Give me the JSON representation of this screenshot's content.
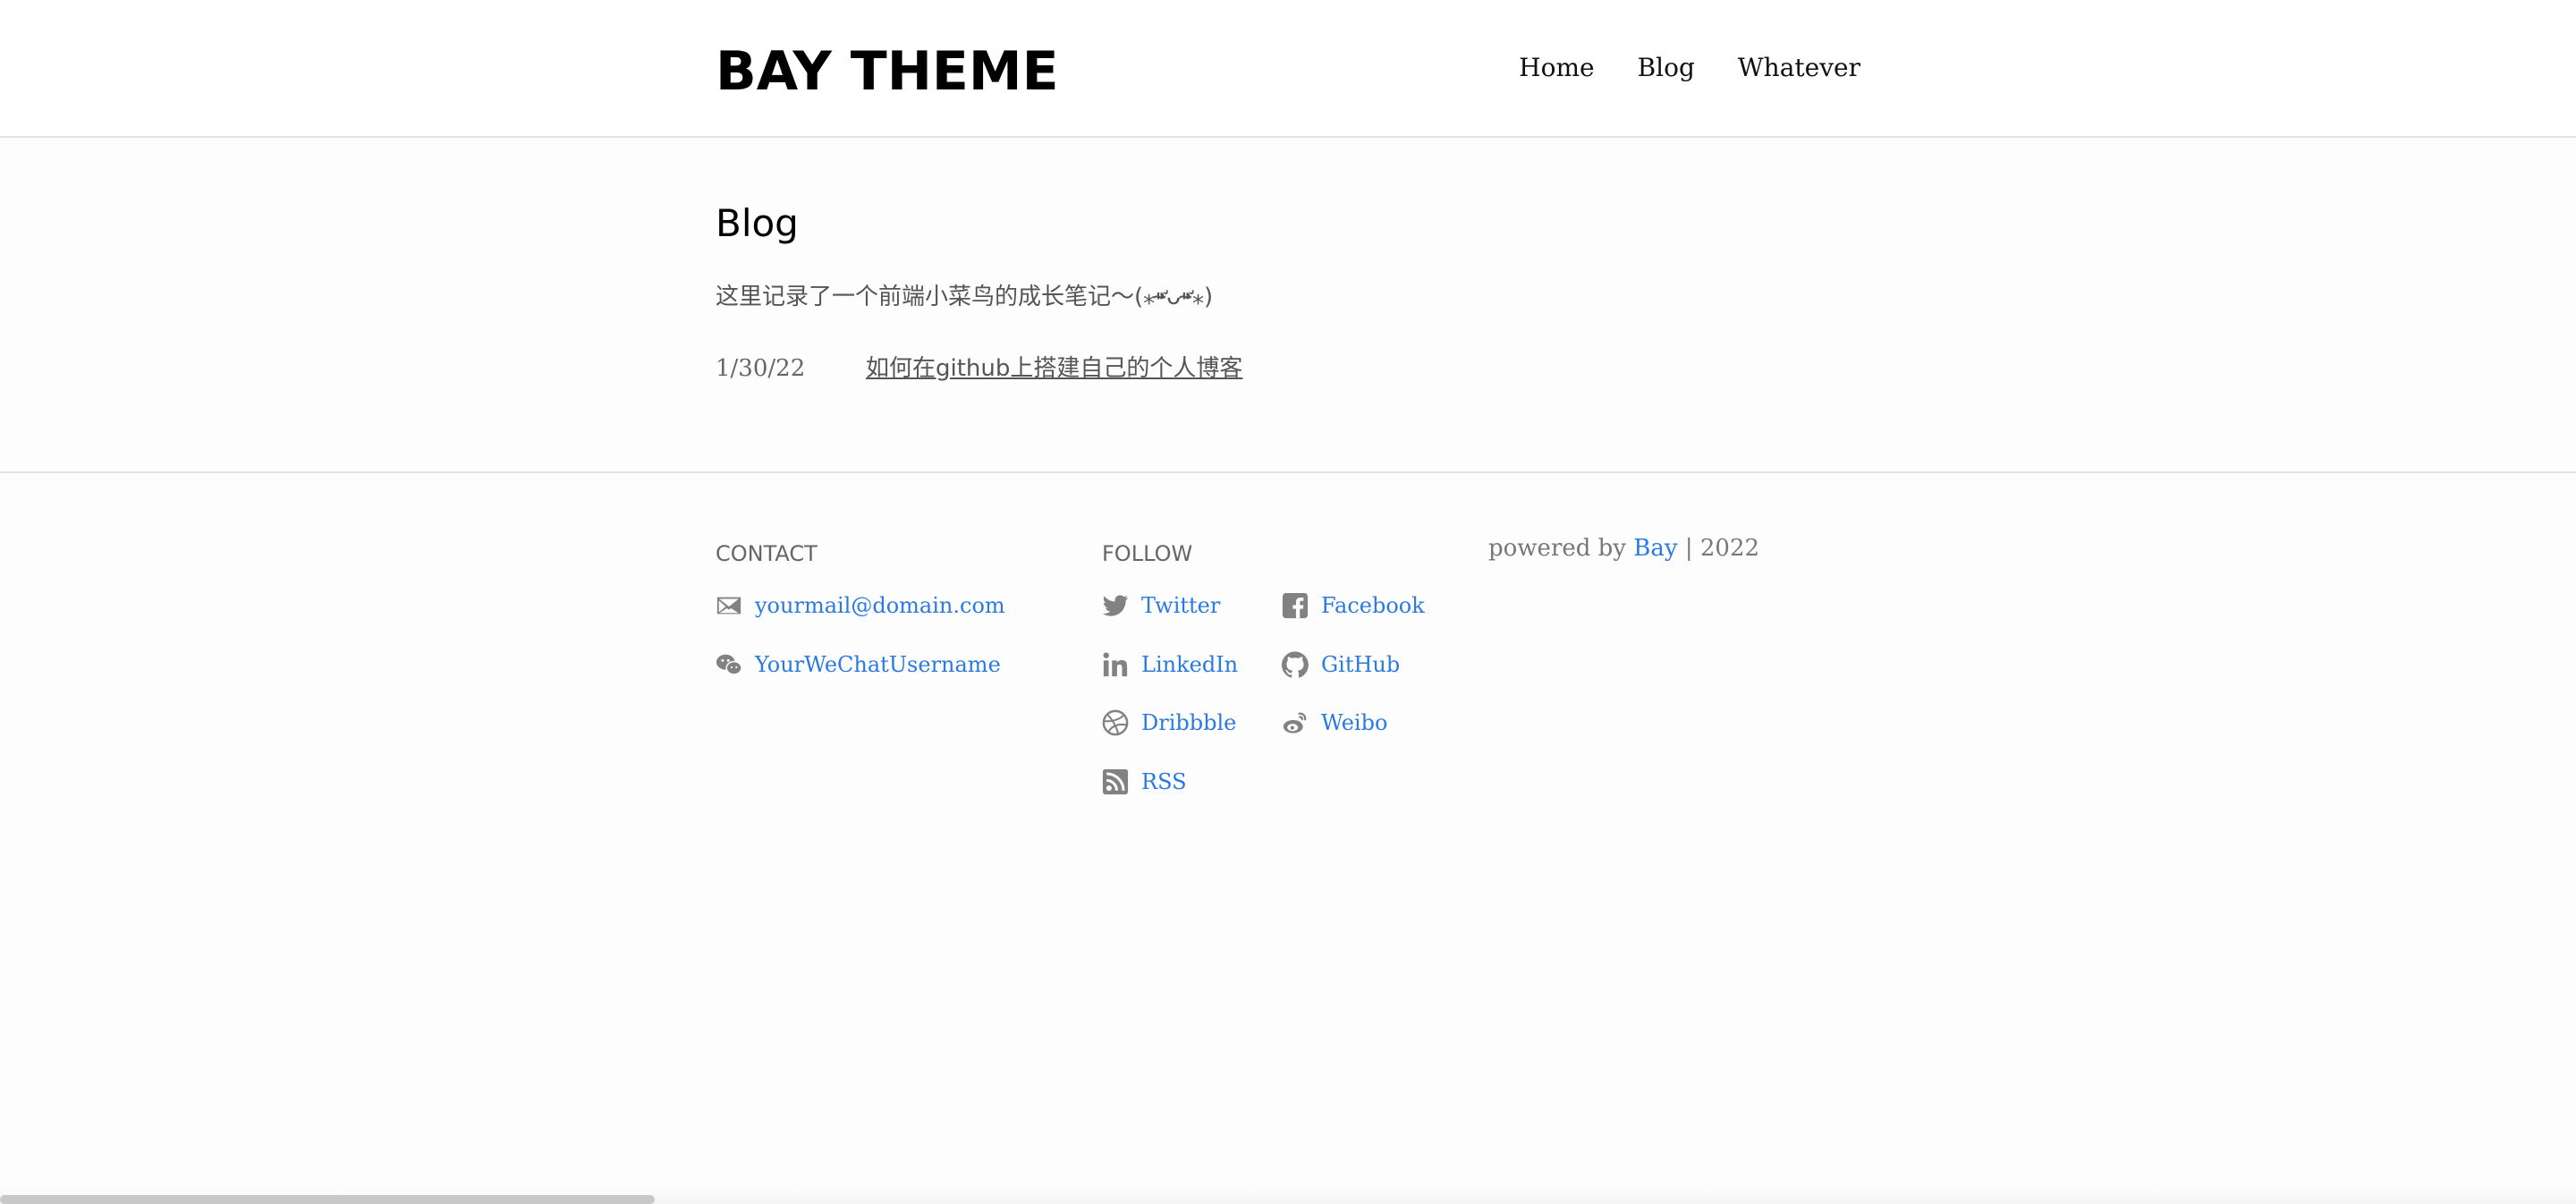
{
  "header": {
    "logo": "BAY THEME",
    "nav": [
      "Home",
      "Blog",
      "Whatever"
    ]
  },
  "main": {
    "title": "Blog",
    "intro": "这里记录了一个前端小菜鸟的成长笔记～(⁎⁍̴̛ᴗ⁍̴̛⁎)",
    "posts": [
      {
        "date": "1/30/22",
        "title": "如何在github上搭建自己的个人博客"
      }
    ]
  },
  "footer": {
    "contact": {
      "heading": "CONTACT",
      "items": [
        {
          "icon": "mail-icon",
          "label": "yourmail@domain.com"
        },
        {
          "icon": "wechat-icon",
          "label": "YourWeChatUsername"
        }
      ]
    },
    "follow": {
      "heading": "FOLLOW",
      "items": [
        {
          "icon": "twitter-icon",
          "label": "Twitter"
        },
        {
          "icon": "facebook-icon",
          "label": "Facebook"
        },
        {
          "icon": "linkedin-icon",
          "label": "LinkedIn"
        },
        {
          "icon": "github-icon",
          "label": "GitHub"
        },
        {
          "icon": "dribbble-icon",
          "label": "Dribbble"
        },
        {
          "icon": "weibo-icon",
          "label": "Weibo"
        },
        {
          "icon": "rss-icon",
          "label": "RSS"
        }
      ]
    },
    "powered": {
      "prefix": "powered by",
      "link": "Bay",
      "separator": "|",
      "year": "2022"
    }
  },
  "colors": {
    "link": "#2a7ae2",
    "icon": "#828282",
    "text_muted": "#666666"
  }
}
